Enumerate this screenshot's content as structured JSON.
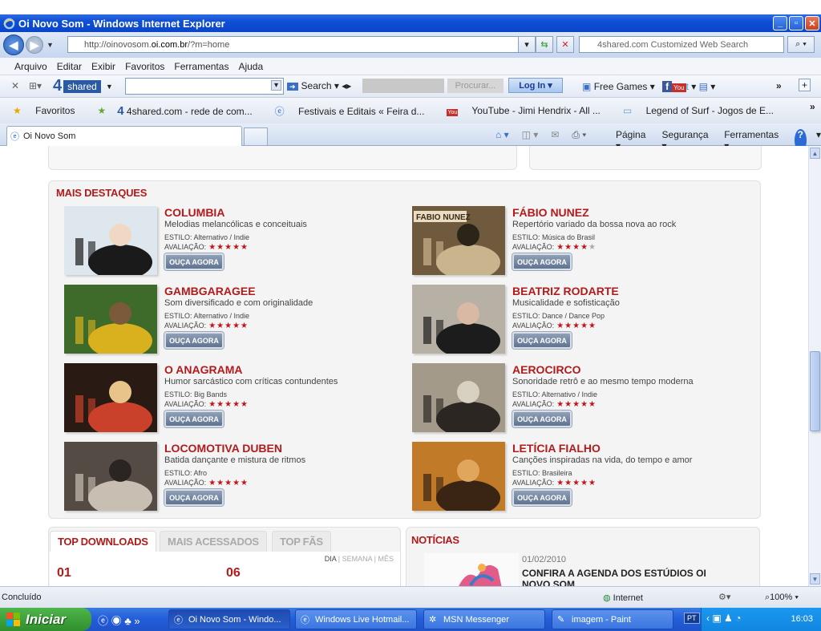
{
  "window": {
    "title": "Oi Novo Som - Windows Internet Explorer"
  },
  "address": {
    "url_prefix": "http://oinovosom.",
    "url_domain": "oi.com.br",
    "url_suffix": "/?m=home",
    "search_placeholder": "4shared.com Customized Web Search"
  },
  "menu": [
    "Arquivo",
    "Editar",
    "Exibir",
    "Favoritos",
    "Ferramentas",
    "Ajuda"
  ],
  "toolbar4s": {
    "brand_num": "4",
    "brand_label": "shared",
    "search_label": "Search",
    "procurar_label": "Procurar...",
    "login_label": "Log In",
    "free_games_label": "Free Games"
  },
  "favorites": {
    "label": "Favoritos",
    "items": [
      "4shared.com - rede de com...",
      "Festivais e Editais « Feira d...",
      "YouTube - Jimi Hendrix - All ...",
      "Legend of Surf - Jogos de E..."
    ]
  },
  "tab": {
    "label": "Oi Novo Som"
  },
  "tabtools": {
    "pagina": "Página",
    "seguranca": "Segurança",
    "ferramentas": "Ferramentas"
  },
  "destaques": {
    "title": "MAIS DESTAQUES",
    "button_label": "OUÇA AGORA",
    "items": [
      {
        "name": "COLUMBIA",
        "desc": "Melodias melancólicas e conceituais",
        "estilo": "ESTILO: Alternativo / Indie",
        "aval_label": "AVALIAÇÃO:",
        "rating": 5
      },
      {
        "name": "FÁBIO NUNEZ",
        "desc": "Repertório variado da bossa nova ao rock",
        "estilo": "ESTILO: Música do Brasil",
        "aval_label": "AVALIAÇÃO:",
        "rating": 4
      },
      {
        "name": "GAMBGARAGEE",
        "desc": "Som diversificado e com originalidade",
        "estilo": "ESTILO: Alternativo / Indie",
        "aval_label": "AVALIAÇÃO:",
        "rating": 5
      },
      {
        "name": "BEATRIZ RODARTE",
        "desc": "Musicalidade e sofisticação",
        "estilo": "ESTILO: Dance / Dance Pop",
        "aval_label": "AVALIAÇÃO:",
        "rating": 5
      },
      {
        "name": "O ANAGRAMA",
        "desc": "Humor sarcástico com críticas contundentes",
        "estilo": "ESTILO: Big Bands",
        "aval_label": "AVALIAÇÃO:",
        "rating": 5
      },
      {
        "name": "AEROCIRCO",
        "desc": "Sonoridade retrô e ao mesmo tempo moderna",
        "estilo": "ESTILO: Alternativo / Indie",
        "aval_label": "AVALIAÇÃO:",
        "rating": 5
      },
      {
        "name": "LOCOMOTIVA DUBEN",
        "desc": "Batida dançante e mistura de ritmos",
        "estilo": "ESTILO: Afro",
        "aval_label": "AVALIAÇÃO:",
        "rating": 5
      },
      {
        "name": "LETÍCIA FIALHO",
        "desc": "Canções inspiradas na vida, do tempo e amor",
        "estilo": "ESTILO: Brasileira",
        "aval_label": "AVALIAÇÃO:",
        "rating": 5
      }
    ],
    "fabio_thumb_text": "FABIO NUNEZ"
  },
  "topdownloads": {
    "tabs": [
      "TOP DOWNLOADS",
      "MAIS ACESSADOS",
      "TOP FÃS"
    ],
    "period": {
      "dia": "DIA",
      "semana": "SEMANA",
      "mes": "MÊS"
    },
    "ranks": [
      "01",
      "06"
    ]
  },
  "noticias": {
    "title": "NOTÍCIAS",
    "date": "01/02/2010",
    "headline": "CONFIRA A AGENDA DOS ESTÚDIOS OI NOVO SOM"
  },
  "status": {
    "text": "Concluído",
    "zone": "Internet",
    "zoom": "100%"
  },
  "taskbar": {
    "start": "Iniciar",
    "items": [
      "Oi Novo Som - Windo...",
      "Windows Live Hotmail...",
      "MSN Messenger",
      "imagem - Paint"
    ],
    "lang": "PT",
    "clock": "16:03"
  },
  "colors": {
    "brand_red": "#b21b1b",
    "xp_blue": "#245edb",
    "start_green": "#2f8f2c"
  }
}
